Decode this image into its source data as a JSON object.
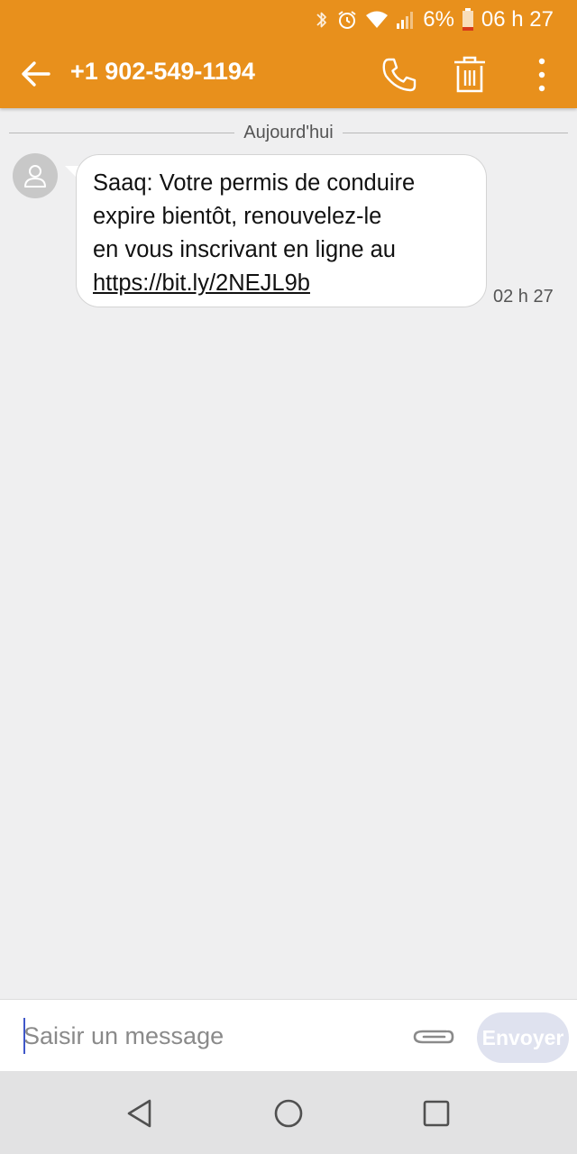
{
  "status_bar": {
    "battery_percent": "6%",
    "time": "06 h 27"
  },
  "toolbar": {
    "contact": "+1 902-549-1194"
  },
  "conversation": {
    "date_label": "Aujourd'hui",
    "messages": [
      {
        "text_lines": [
          "Saaq: Votre permis de conduire",
          "expire bientôt, renouvelez-le",
          "en vous inscrivant en ligne au"
        ],
        "link": "https://bit.ly/2NEJL9b",
        "time": "02 h 27"
      }
    ]
  },
  "compose": {
    "placeholder": "Saisir un message",
    "send_label": "Envoyer"
  },
  "colors": {
    "accent": "#e8901c",
    "background": "#efeff0",
    "send_disabled": "#dfe2ef"
  }
}
